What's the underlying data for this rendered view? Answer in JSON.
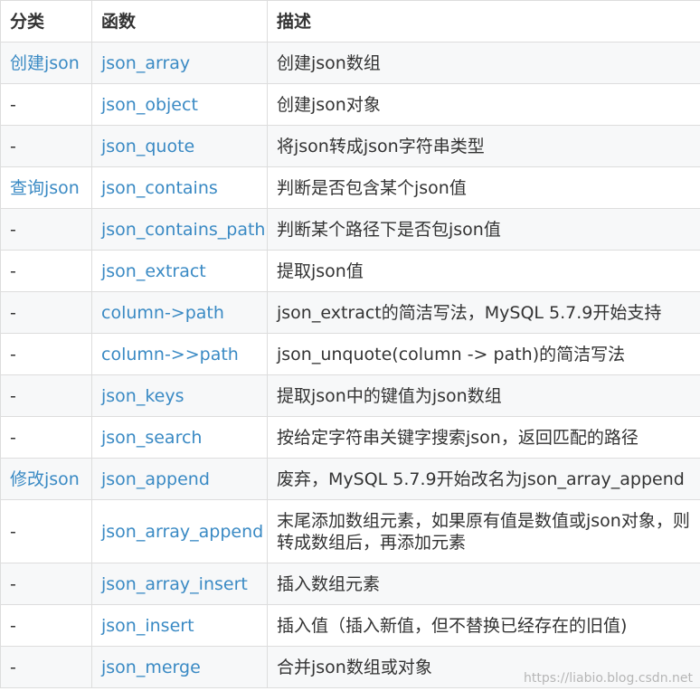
{
  "headers": [
    "分类",
    "函数",
    "描述"
  ],
  "rows": [
    {
      "category": "创建json",
      "function": "json_array",
      "description": "创建json数组"
    },
    {
      "category": "-",
      "function": "json_object",
      "description": "创建json对象"
    },
    {
      "category": "-",
      "function": "json_quote",
      "description": "将json转成json字符串类型"
    },
    {
      "category": "查询json",
      "function": "json_contains",
      "description": "判断是否包含某个json值"
    },
    {
      "category": "-",
      "function": "json_contains_path",
      "description": "判断某个路径下是否包json值"
    },
    {
      "category": "-",
      "function": "json_extract",
      "description": "提取json值"
    },
    {
      "category": "-",
      "function": "column->path",
      "description": "json_extract的简洁写法，MySQL 5.7.9开始支持"
    },
    {
      "category": "-",
      "function": "column->>path",
      "description": "json_unquote(column -> path)的简洁写法"
    },
    {
      "category": "-",
      "function": "json_keys",
      "description": "提取json中的键值为json数组"
    },
    {
      "category": "-",
      "function": "json_search",
      "description": "按给定字符串关键字搜索json，返回匹配的路径"
    },
    {
      "category": "修改json",
      "function": "json_append",
      "description": "废弃，MySQL 5.7.9开始改名为json_array_append"
    },
    {
      "category": "-",
      "function": "json_array_append",
      "description": "末尾添加数组元素，如果原有值是数值或json对象，则转成数组后，再添加元素"
    },
    {
      "category": "-",
      "function": "json_array_insert",
      "description": "插入数组元素"
    },
    {
      "category": "-",
      "function": "json_insert",
      "description": "插入值（插入新值，但不替换已经存在的旧值)"
    },
    {
      "category": "-",
      "function": "json_merge",
      "description": "合并json数组或对象"
    }
  ],
  "watermark": "https://liabio.blog.csdn.net",
  "colors": {
    "link": "#3a8ac4",
    "text": "#333333",
    "border": "#dddddd",
    "stripe": "#f7f8f9"
  }
}
